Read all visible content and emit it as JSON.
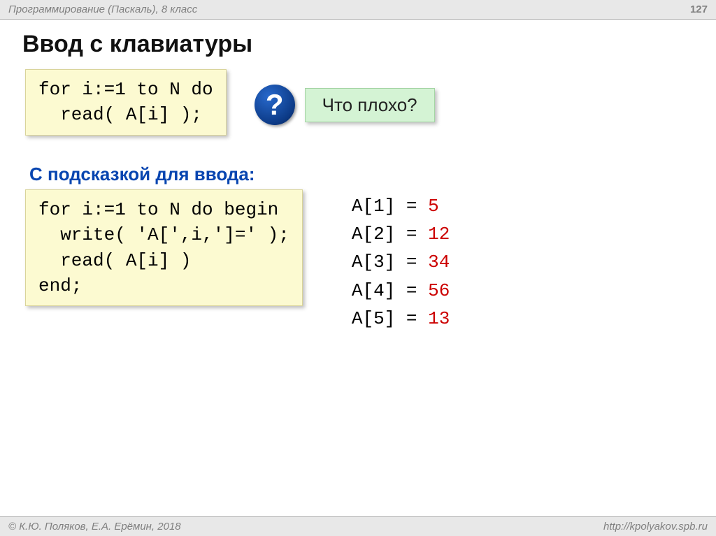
{
  "header": {
    "course": "Программирование (Паскаль), 8 класс",
    "page": "127"
  },
  "title": "Ввод с клавиатуры",
  "code1": {
    "line1": "for i:=1 to N do",
    "line2": "  read( A[i] );"
  },
  "question": {
    "mark": "?",
    "text": "Что плохо?"
  },
  "subtitle": "С подсказкой для ввода:",
  "code2": {
    "line1": "for i:=1 to N do begin",
    "line2": "  write( 'A[',i,']=' );",
    "line3": "  read( A[i] )",
    "line4": "end;"
  },
  "output": [
    {
      "label": "A[1] =",
      "value": "5"
    },
    {
      "label": "A[2] =",
      "value": "12"
    },
    {
      "label": "A[3] =",
      "value": "34"
    },
    {
      "label": "A[4] =",
      "value": "56"
    },
    {
      "label": "A[5] =",
      "value": "13"
    }
  ],
  "footer": {
    "authors": "© К.Ю. Поляков, Е.А. Ерёмин, 2018",
    "url": "http://kpolyakov.spb.ru"
  }
}
